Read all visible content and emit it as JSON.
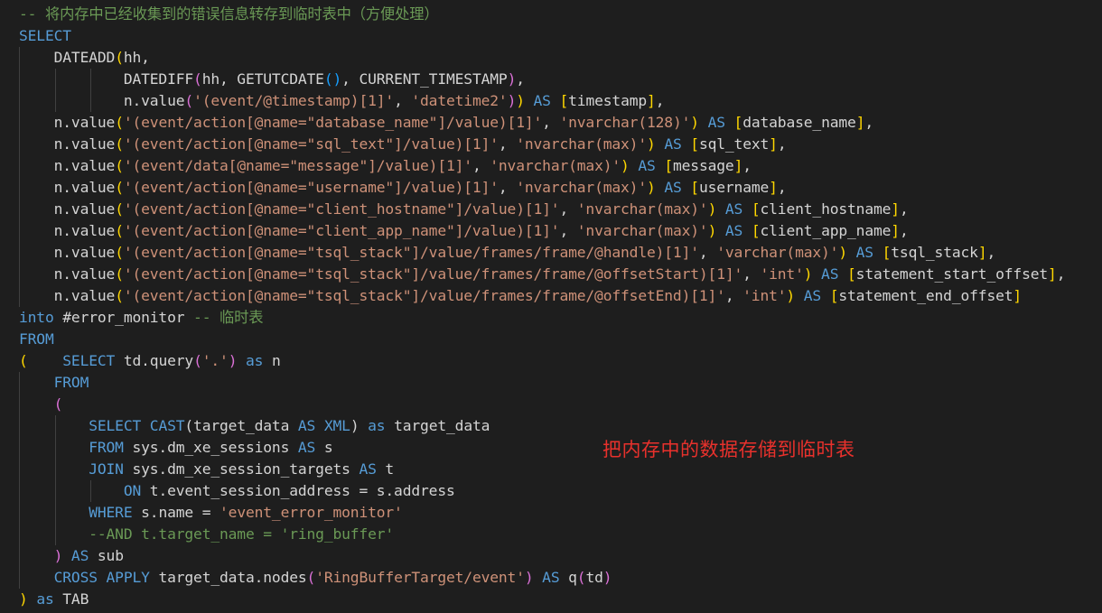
{
  "editor": {
    "language": "sql",
    "colors": {
      "background": "#1e1e1e",
      "keyword": "#569cd6",
      "string": "#ce9178",
      "comment": "#6a9955",
      "identifier": "#d4d4d4",
      "bracket_level1": "#ffd700",
      "bracket_level2": "#da70d6",
      "bracket_level3": "#179fff",
      "annotation": "#e8312c"
    },
    "lines": [
      [
        {
          "t": "cm",
          "v": "-- 将内存中已经收集到的错误信息转存到临时表中（方便处理）"
        }
      ],
      [
        {
          "t": "kw",
          "v": "SELECT"
        }
      ],
      [
        {
          "t": "id",
          "v": "    DATEADD"
        },
        {
          "t": "b1",
          "v": "("
        },
        {
          "t": "id",
          "v": "hh,"
        }
      ],
      [
        {
          "t": "id",
          "v": "            DATEDIFF"
        },
        {
          "t": "b2",
          "v": "("
        },
        {
          "t": "id",
          "v": "hh, GETUTCDATE"
        },
        {
          "t": "b3",
          "v": "()"
        },
        {
          "t": "id",
          "v": ", CURRENT_TIMESTAMP"
        },
        {
          "t": "b2",
          "v": ")"
        },
        {
          "t": "id",
          "v": ","
        }
      ],
      [
        {
          "t": "id",
          "v": "            n.value"
        },
        {
          "t": "b2",
          "v": "("
        },
        {
          "t": "str",
          "v": "'(event/@timestamp)[1]'"
        },
        {
          "t": "id",
          "v": ", "
        },
        {
          "t": "str",
          "v": "'datetime2'"
        },
        {
          "t": "b2",
          "v": ")"
        },
        {
          "t": "b1",
          "v": ")"
        },
        {
          "t": "id",
          "v": " "
        },
        {
          "t": "kw",
          "v": "AS"
        },
        {
          "t": "id",
          "v": " "
        },
        {
          "t": "b1",
          "v": "["
        },
        {
          "t": "id",
          "v": "timestamp"
        },
        {
          "t": "b1",
          "v": "]"
        },
        {
          "t": "id",
          "v": ","
        }
      ],
      [
        {
          "t": "id",
          "v": "    n.value"
        },
        {
          "t": "b1",
          "v": "("
        },
        {
          "t": "str",
          "v": "'(event/action[@name=\"database_name\"]/value)[1]'"
        },
        {
          "t": "id",
          "v": ", "
        },
        {
          "t": "str",
          "v": "'nvarchar(128)'"
        },
        {
          "t": "b1",
          "v": ")"
        },
        {
          "t": "id",
          "v": " "
        },
        {
          "t": "kw",
          "v": "AS"
        },
        {
          "t": "id",
          "v": " "
        },
        {
          "t": "b1",
          "v": "["
        },
        {
          "t": "id",
          "v": "database_name"
        },
        {
          "t": "b1",
          "v": "]"
        },
        {
          "t": "id",
          "v": ","
        }
      ],
      [
        {
          "t": "id",
          "v": "    n.value"
        },
        {
          "t": "b1",
          "v": "("
        },
        {
          "t": "str",
          "v": "'(event/action[@name=\"sql_text\"]/value)[1]'"
        },
        {
          "t": "id",
          "v": ", "
        },
        {
          "t": "str",
          "v": "'nvarchar(max)'"
        },
        {
          "t": "b1",
          "v": ")"
        },
        {
          "t": "id",
          "v": " "
        },
        {
          "t": "kw",
          "v": "AS"
        },
        {
          "t": "id",
          "v": " "
        },
        {
          "t": "b1",
          "v": "["
        },
        {
          "t": "id",
          "v": "sql_text"
        },
        {
          "t": "b1",
          "v": "]"
        },
        {
          "t": "id",
          "v": ","
        }
      ],
      [
        {
          "t": "id",
          "v": "    n.value"
        },
        {
          "t": "b1",
          "v": "("
        },
        {
          "t": "str",
          "v": "'(event/data[@name=\"message\"]/value)[1]'"
        },
        {
          "t": "id",
          "v": ", "
        },
        {
          "t": "str",
          "v": "'nvarchar(max)'"
        },
        {
          "t": "b1",
          "v": ")"
        },
        {
          "t": "id",
          "v": " "
        },
        {
          "t": "kw",
          "v": "AS"
        },
        {
          "t": "id",
          "v": " "
        },
        {
          "t": "b1",
          "v": "["
        },
        {
          "t": "id",
          "v": "message"
        },
        {
          "t": "b1",
          "v": "]"
        },
        {
          "t": "id",
          "v": ","
        }
      ],
      [
        {
          "t": "id",
          "v": "    n.value"
        },
        {
          "t": "b1",
          "v": "("
        },
        {
          "t": "str",
          "v": "'(event/action[@name=\"username\"]/value)[1]'"
        },
        {
          "t": "id",
          "v": ", "
        },
        {
          "t": "str",
          "v": "'nvarchar(max)'"
        },
        {
          "t": "b1",
          "v": ")"
        },
        {
          "t": "id",
          "v": " "
        },
        {
          "t": "kw",
          "v": "AS"
        },
        {
          "t": "id",
          "v": " "
        },
        {
          "t": "b1",
          "v": "["
        },
        {
          "t": "id",
          "v": "username"
        },
        {
          "t": "b1",
          "v": "]"
        },
        {
          "t": "id",
          "v": ","
        }
      ],
      [
        {
          "t": "id",
          "v": "    n.value"
        },
        {
          "t": "b1",
          "v": "("
        },
        {
          "t": "str",
          "v": "'(event/action[@name=\"client_hostname\"]/value)[1]'"
        },
        {
          "t": "id",
          "v": ", "
        },
        {
          "t": "str",
          "v": "'nvarchar(max)'"
        },
        {
          "t": "b1",
          "v": ")"
        },
        {
          "t": "id",
          "v": " "
        },
        {
          "t": "kw",
          "v": "AS"
        },
        {
          "t": "id",
          "v": " "
        },
        {
          "t": "b1",
          "v": "["
        },
        {
          "t": "id",
          "v": "client_hostname"
        },
        {
          "t": "b1",
          "v": "]"
        },
        {
          "t": "id",
          "v": ","
        }
      ],
      [
        {
          "t": "id",
          "v": "    n.value"
        },
        {
          "t": "b1",
          "v": "("
        },
        {
          "t": "str",
          "v": "'(event/action[@name=\"client_app_name\"]/value)[1]'"
        },
        {
          "t": "id",
          "v": ", "
        },
        {
          "t": "str",
          "v": "'nvarchar(max)'"
        },
        {
          "t": "b1",
          "v": ")"
        },
        {
          "t": "id",
          "v": " "
        },
        {
          "t": "kw",
          "v": "AS"
        },
        {
          "t": "id",
          "v": " "
        },
        {
          "t": "b1",
          "v": "["
        },
        {
          "t": "id",
          "v": "client_app_name"
        },
        {
          "t": "b1",
          "v": "]"
        },
        {
          "t": "id",
          "v": ","
        }
      ],
      [
        {
          "t": "id",
          "v": "    n.value"
        },
        {
          "t": "b1",
          "v": "("
        },
        {
          "t": "str",
          "v": "'(event/action[@name=\"tsql_stack\"]/value/frames/frame/@handle)[1]'"
        },
        {
          "t": "id",
          "v": ", "
        },
        {
          "t": "str",
          "v": "'varchar(max)'"
        },
        {
          "t": "b1",
          "v": ")"
        },
        {
          "t": "id",
          "v": " "
        },
        {
          "t": "kw",
          "v": "AS"
        },
        {
          "t": "id",
          "v": " "
        },
        {
          "t": "b1",
          "v": "["
        },
        {
          "t": "id",
          "v": "tsql_stack"
        },
        {
          "t": "b1",
          "v": "]"
        },
        {
          "t": "id",
          "v": ","
        }
      ],
      [
        {
          "t": "id",
          "v": "    n.value"
        },
        {
          "t": "b1",
          "v": "("
        },
        {
          "t": "str",
          "v": "'(event/action[@name=\"tsql_stack\"]/value/frames/frame/@offsetStart)[1]'"
        },
        {
          "t": "id",
          "v": ", "
        },
        {
          "t": "str",
          "v": "'int'"
        },
        {
          "t": "b1",
          "v": ")"
        },
        {
          "t": "id",
          "v": " "
        },
        {
          "t": "kw",
          "v": "AS"
        },
        {
          "t": "id",
          "v": " "
        },
        {
          "t": "b1",
          "v": "["
        },
        {
          "t": "id",
          "v": "statement_start_offset"
        },
        {
          "t": "b1",
          "v": "]"
        },
        {
          "t": "id",
          "v": ","
        }
      ],
      [
        {
          "t": "id",
          "v": "    n.value"
        },
        {
          "t": "b1",
          "v": "("
        },
        {
          "t": "str",
          "v": "'(event/action[@name=\"tsql_stack\"]/value/frames/frame/@offsetEnd)[1]'"
        },
        {
          "t": "id",
          "v": ", "
        },
        {
          "t": "str",
          "v": "'int'"
        },
        {
          "t": "b1",
          "v": ")"
        },
        {
          "t": "id",
          "v": " "
        },
        {
          "t": "kw",
          "v": "AS"
        },
        {
          "t": "id",
          "v": " "
        },
        {
          "t": "b1",
          "v": "["
        },
        {
          "t": "id",
          "v": "statement_end_offset"
        },
        {
          "t": "b1",
          "v": "]"
        }
      ],
      [
        {
          "t": "kw",
          "v": "into"
        },
        {
          "t": "id",
          "v": " #error_monitor "
        },
        {
          "t": "cm",
          "v": "-- 临时表"
        }
      ],
      [
        {
          "t": "kw",
          "v": "FROM"
        }
      ],
      [
        {
          "t": "b1",
          "v": "("
        },
        {
          "t": "id",
          "v": "    "
        },
        {
          "t": "kw",
          "v": "SELECT"
        },
        {
          "t": "id",
          "v": " td.query"
        },
        {
          "t": "b2",
          "v": "("
        },
        {
          "t": "str",
          "v": "'.'"
        },
        {
          "t": "b2",
          "v": ")"
        },
        {
          "t": "id",
          "v": " "
        },
        {
          "t": "kw",
          "v": "as"
        },
        {
          "t": "id",
          "v": " n"
        }
      ],
      [
        {
          "t": "id",
          "v": "    "
        },
        {
          "t": "kw",
          "v": "FROM"
        }
      ],
      [
        {
          "t": "id",
          "v": "    "
        },
        {
          "t": "b2",
          "v": "("
        }
      ],
      [
        {
          "t": "id",
          "v": "        "
        },
        {
          "t": "kw",
          "v": "SELECT"
        },
        {
          "t": "id",
          "v": " "
        },
        {
          "t": "kw",
          "v": "CAST"
        },
        {
          "t": "id",
          "v": "(target_data "
        },
        {
          "t": "kw",
          "v": "AS"
        },
        {
          "t": "id",
          "v": " "
        },
        {
          "t": "kw",
          "v": "XML"
        },
        {
          "t": "id",
          "v": ") "
        },
        {
          "t": "kw",
          "v": "as"
        },
        {
          "t": "id",
          "v": " target_data"
        }
      ],
      [
        {
          "t": "id",
          "v": "        "
        },
        {
          "t": "kw",
          "v": "FROM"
        },
        {
          "t": "id",
          "v": " sys.dm_xe_sessions "
        },
        {
          "t": "kw",
          "v": "AS"
        },
        {
          "t": "id",
          "v": " s"
        }
      ],
      [
        {
          "t": "id",
          "v": "        "
        },
        {
          "t": "kw",
          "v": "JOIN"
        },
        {
          "t": "id",
          "v": " sys.dm_xe_session_targets "
        },
        {
          "t": "kw",
          "v": "AS"
        },
        {
          "t": "id",
          "v": " t"
        }
      ],
      [
        {
          "t": "id",
          "v": "            "
        },
        {
          "t": "kw",
          "v": "ON"
        },
        {
          "t": "id",
          "v": " t.event_session_address = s.address"
        }
      ],
      [
        {
          "t": "id",
          "v": "        "
        },
        {
          "t": "kw",
          "v": "WHERE"
        },
        {
          "t": "id",
          "v": " s.name = "
        },
        {
          "t": "str",
          "v": "'event_error_monitor'"
        }
      ],
      [
        {
          "t": "id",
          "v": "        "
        },
        {
          "t": "cm",
          "v": "--AND t.target_name = 'ring_buffer'"
        }
      ],
      [
        {
          "t": "id",
          "v": "    "
        },
        {
          "t": "b2",
          "v": ")"
        },
        {
          "t": "id",
          "v": " "
        },
        {
          "t": "kw",
          "v": "AS"
        },
        {
          "t": "id",
          "v": " sub"
        }
      ],
      [
        {
          "t": "id",
          "v": "    "
        },
        {
          "t": "kw",
          "v": "CROSS APPLY"
        },
        {
          "t": "id",
          "v": " target_data.nodes"
        },
        {
          "t": "b2",
          "v": "("
        },
        {
          "t": "str",
          "v": "'RingBufferTarget/event'"
        },
        {
          "t": "b2",
          "v": ")"
        },
        {
          "t": "id",
          "v": " "
        },
        {
          "t": "kw",
          "v": "AS"
        },
        {
          "t": "id",
          "v": " q"
        },
        {
          "t": "b2",
          "v": "("
        },
        {
          "t": "id",
          "v": "td"
        },
        {
          "t": "b2",
          "v": ")"
        }
      ],
      [
        {
          "t": "b1",
          "v": ")"
        },
        {
          "t": "id",
          "v": " "
        },
        {
          "t": "kw",
          "v": "as"
        },
        {
          "t": "id",
          "v": " TAB"
        }
      ]
    ]
  },
  "annotation": {
    "text": "把内存中的数据存储到临时表"
  }
}
